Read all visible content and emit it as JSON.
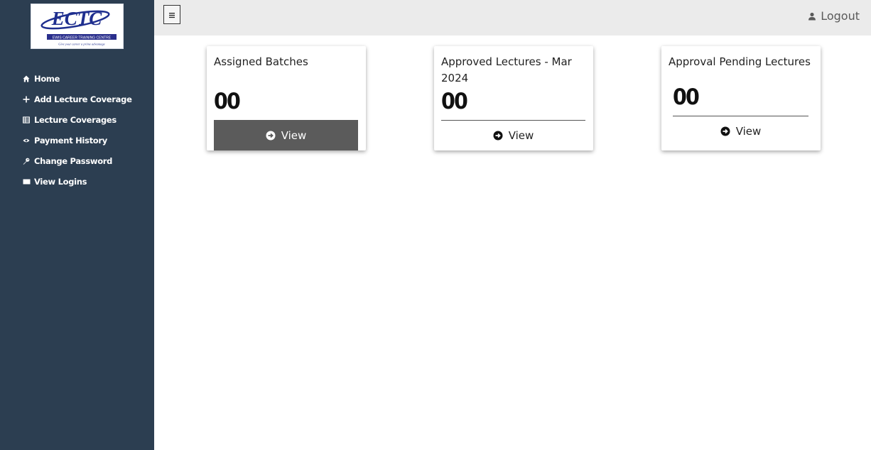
{
  "logo": {
    "brand_text": "ECTC",
    "name_text": "EWIS CAREER TRAINING CENTRE",
    "tagline_text": "Give your career a prime advantage"
  },
  "sidebar": {
    "items": [
      {
        "label": "Home",
        "icon": "home-icon"
      },
      {
        "label": "Add Lecture Coverage",
        "icon": "plus-icon"
      },
      {
        "label": "Lecture Coverages",
        "icon": "table-icon"
      },
      {
        "label": "Payment History",
        "icon": "eye-icon"
      },
      {
        "label": "Change Password",
        "icon": "key-icon"
      },
      {
        "label": "View Logins",
        "icon": "screen-icon"
      }
    ]
  },
  "topbar": {
    "menu_icon": "hamburger-icon",
    "logout_label": "Logout",
    "logout_icon": "user-icon"
  },
  "cards": [
    {
      "title": "Assigned Batches",
      "count": "00",
      "view_label": "View"
    },
    {
      "title": "Approved Lectures - Mar 2024",
      "count": "00",
      "view_label": "View"
    },
    {
      "title": "Approval Pending Lectures",
      "count": "00",
      "view_label": "View"
    }
  ],
  "colors": {
    "sidebar_bg": "#2c3e51",
    "topbar_bg": "#ebebeb",
    "primary_button_bg": "#5b5b5b",
    "logo_blue": "#1f2f8f"
  }
}
